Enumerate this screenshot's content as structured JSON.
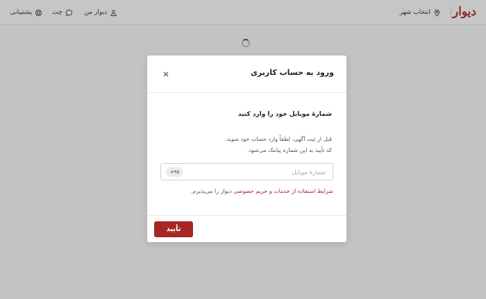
{
  "header": {
    "logo": "دیوار",
    "city_label": "انتخاب شهر",
    "my_divar_label": "دیوار من",
    "chat_label": "چت",
    "support_label": "پشتیبانی"
  },
  "icons": {
    "city": "location-pin-icon",
    "my_divar": "user-icon",
    "chat": "chat-bubble-icon",
    "support": "lifebuoy-icon",
    "close": "close-icon",
    "loading": "spinner-icon"
  },
  "modal": {
    "title": "ورود به حساب کاربری",
    "heading": "شمارهٔ موبایل خود را وارد کنید",
    "description_line1": "قبل از ثبت آگهی، لطفاً وارد حساب خود شوید.",
    "description_line2": "کد تأیید به این شماره پیامک می‌شود.",
    "phone_placeholder": "شمارهٔ موبایل",
    "phone_value": "",
    "phone_prefix": "+۹۸",
    "terms": {
      "link_terms": "شرایط استفاده از خدمات",
      "conjunction": " و ",
      "link_privacy": "حریم خصوصی",
      "suffix": " دیوار را می‌پذیرم."
    },
    "confirm_label": "تأیید"
  },
  "colors": {
    "brand": "#a62626",
    "overlay": "#c3c3c3"
  }
}
